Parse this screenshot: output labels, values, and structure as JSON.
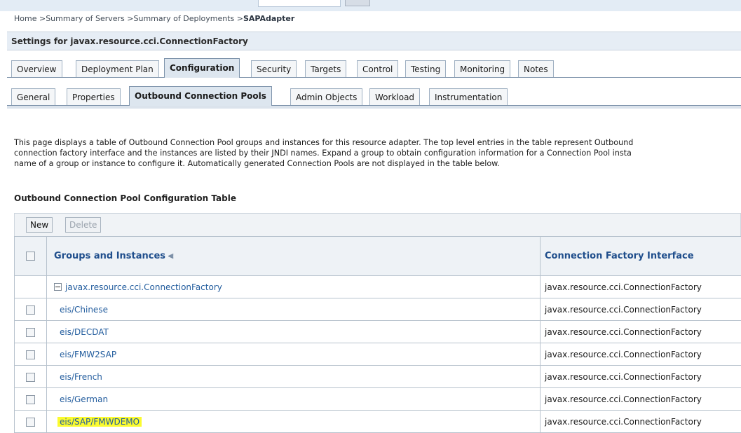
{
  "breadcrumb": {
    "items": [
      "Home",
      "Summary of Servers",
      "Summary of Deployments"
    ],
    "current": "SAPAdapter",
    "separator": " >"
  },
  "settings_title": "Settings for javax.resource.cci.ConnectionFactory",
  "main_tabs": [
    {
      "label": "Overview"
    },
    {
      "label": "Deployment Plan"
    },
    {
      "label": "Configuration",
      "active": true
    },
    {
      "label": "Security"
    },
    {
      "label": "Targets"
    },
    {
      "label": "Control"
    },
    {
      "label": "Testing"
    },
    {
      "label": "Monitoring"
    },
    {
      "label": "Notes"
    }
  ],
  "sub_tabs": [
    {
      "label": "General"
    },
    {
      "label": "Properties"
    },
    {
      "label": "Outbound Connection Pools",
      "active": true
    },
    {
      "label": "Admin Objects"
    },
    {
      "label": "Workload"
    },
    {
      "label": "Instrumentation"
    }
  ],
  "description": {
    "line1": "This page displays a table of Outbound Connection Pool groups and instances for this resource adapter. The top level entries in the table represent Outbound",
    "line2": "connection factory interface and the instances are listed by their JNDI names. Expand a group to obtain configuration information for a Connection Pool insta",
    "line3": "name of a group or instance to configure it. Automatically generated Connection Pools are not displayed in the table below."
  },
  "table": {
    "title": "Outbound Connection Pool Configuration Table",
    "new_label": "New",
    "delete_label": "Delete",
    "col_groups": "Groups and Instances",
    "col_interface": "Connection Factory Interface",
    "group": {
      "name": "javax.resource.cci.ConnectionFactory",
      "interface": "javax.resource.cci.ConnectionFactory"
    },
    "rows": [
      {
        "name": "eis/Chinese",
        "interface": "javax.resource.cci.ConnectionFactory"
      },
      {
        "name": "eis/DECDAT",
        "interface": "javax.resource.cci.ConnectionFactory"
      },
      {
        "name": "eis/FMW2SAP",
        "interface": "javax.resource.cci.ConnectionFactory"
      },
      {
        "name": "eis/French",
        "interface": "javax.resource.cci.ConnectionFactory"
      },
      {
        "name": "eis/German",
        "interface": "javax.resource.cci.ConnectionFactory"
      },
      {
        "name": "eis/SAP/FMWDEMO",
        "interface": "javax.resource.cci.ConnectionFactory",
        "highlighted": true
      }
    ]
  },
  "colors": {
    "link": "#235d9e",
    "header_text": "#1f4e8c",
    "highlight": "#fbfb2f"
  }
}
